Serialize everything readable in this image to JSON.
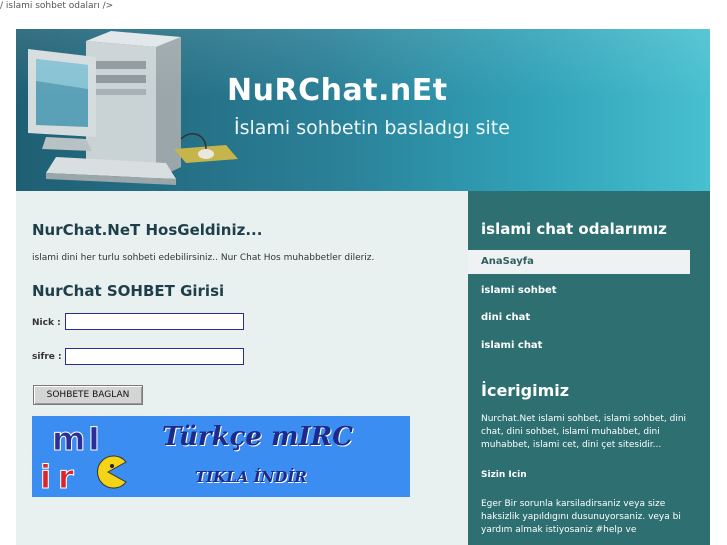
{
  "breadcrumb": "/ islami sohbet odaları />",
  "header": {
    "title": "NuRChat.nEt",
    "tagline": "İslami sohbetin basladıgı site"
  },
  "welcome": {
    "title": "NurChat.NeT HosGeldiniz...",
    "text": "islami dini her turlu sohbeti edebilirsiniz.. Nur Chat Hos muhabbetler dileriz."
  },
  "login": {
    "title": "NurChat SOHBET Girisi",
    "nick_label": "Nick :",
    "nick_value": "",
    "password_label": "sifre :",
    "password_value": "",
    "submit_label": "SOHBETE BAGLAN"
  },
  "banner": {
    "logo_text": "mIRC",
    "title": "Türkçe mIRC",
    "subtitle": "TIKLA İNDİR"
  },
  "sidebar": {
    "rooms_heading": "islami chat odalarımız",
    "nav": [
      {
        "label": "AnaSayfa",
        "active": true
      },
      {
        "label": "islami sohbet",
        "active": false
      },
      {
        "label": "dini chat",
        "active": false
      },
      {
        "label": "islami chat",
        "active": false
      }
    ],
    "content_heading": "İcerigimiz",
    "content_text": "Nurchat.Net islami sohbet, islami sohbet, dini chat, dini sohbet, islami muhabbet, dini muhabbet, islami cet, dini çet sitesidir...",
    "sizin_icin": "Sizin Icin",
    "help_text": "Eger Bir sorunla karsiladirsaniz veya size haksizlik yapıldıgını dusunuyorsaniz. veya bi yardım almak istiyosaniz #help ve"
  },
  "colors": {
    "header_start": "#1f5f74",
    "header_end": "#48c0d0",
    "sidebar": "#2e6f71",
    "content_bg": "#e8f0f0",
    "banner_bg": "#3b8df2"
  }
}
